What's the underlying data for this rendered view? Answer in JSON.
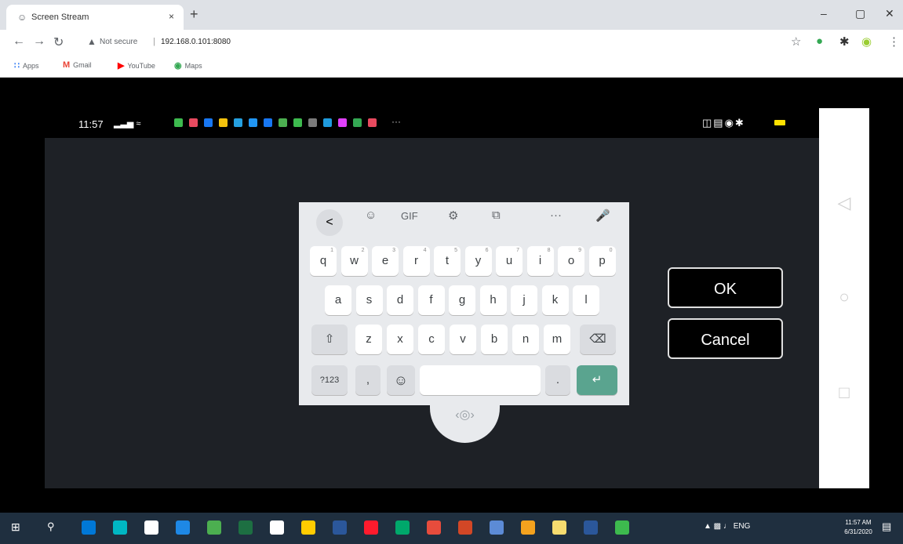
{
  "browser": {
    "tab_title": "Screen Stream",
    "close_tab": "×",
    "new_tab": "+",
    "win_min": "–",
    "win_max": "▢",
    "win_close": "✕",
    "not_secure": "Not secure",
    "url": "192.168.0.101:8080",
    "bookmarks": [
      {
        "label": "Apps",
        "icon": "apps-icon",
        "color": "#4285f4"
      },
      {
        "label": "Gmail",
        "icon": "gmail-icon",
        "color": "#ea4335"
      },
      {
        "label": "YouTube",
        "icon": "youtube-icon",
        "color": "#ff0000"
      },
      {
        "label": "Maps",
        "icon": "maps-icon",
        "color": "#34a853"
      }
    ]
  },
  "phone": {
    "time": "11:57",
    "status_icons": [
      "#3dba4e",
      "#e84a5f",
      "#1877f2",
      "#f4c20d",
      "#25a0e0",
      "#2196f3",
      "#1877f2",
      "#4caf50",
      "#3dba4e",
      "#7b7b7b",
      "#1f9bde",
      "#e040fb",
      "#34a853",
      "#e84a5f"
    ],
    "nav": [
      "◁",
      "○",
      "□"
    ]
  },
  "keyboard": {
    "toolbar": [
      "<",
      "☺",
      "GIF",
      "⚙",
      "⧉",
      "···",
      "🎤"
    ],
    "row1": [
      {
        "k": "q",
        "h": "1"
      },
      {
        "k": "w",
        "h": "2"
      },
      {
        "k": "e",
        "h": "3"
      },
      {
        "k": "r",
        "h": "4"
      },
      {
        "k": "t",
        "h": "5"
      },
      {
        "k": "y",
        "h": "6"
      },
      {
        "k": "u",
        "h": "7"
      },
      {
        "k": "i",
        "h": "8"
      },
      {
        "k": "o",
        "h": "9"
      },
      {
        "k": "p",
        "h": "0"
      }
    ],
    "row2": [
      "a",
      "s",
      "d",
      "f",
      "g",
      "h",
      "j",
      "k",
      "l"
    ],
    "row3": [
      "z",
      "x",
      "c",
      "v",
      "b",
      "n",
      "m"
    ],
    "shift": "⇧",
    "backspace": "⌫",
    "symbols": "?123",
    "comma": ",",
    "emoji": "☺",
    "period": ".",
    "enter": "↵",
    "move": "‹◎›"
  },
  "dialog": {
    "ok": "OK",
    "cancel": "Cancel"
  },
  "taskbar": {
    "apps": [
      "#0078d7",
      "#00b7c3",
      "#ffffff",
      "#1e88e5",
      "#4caf50",
      "#1d6f42",
      "#ffffff",
      "#ffcc00",
      "#2b579a",
      "#ff1b2d",
      "#00a86b",
      "#e74c3c",
      "#d24726",
      "#5c8bd6",
      "#f4a21e",
      "#f7dc6f",
      "#2b579a",
      "#3dba4e"
    ],
    "lang": "ENG",
    "time": "11:57 AM",
    "date": "6/31/2020"
  }
}
